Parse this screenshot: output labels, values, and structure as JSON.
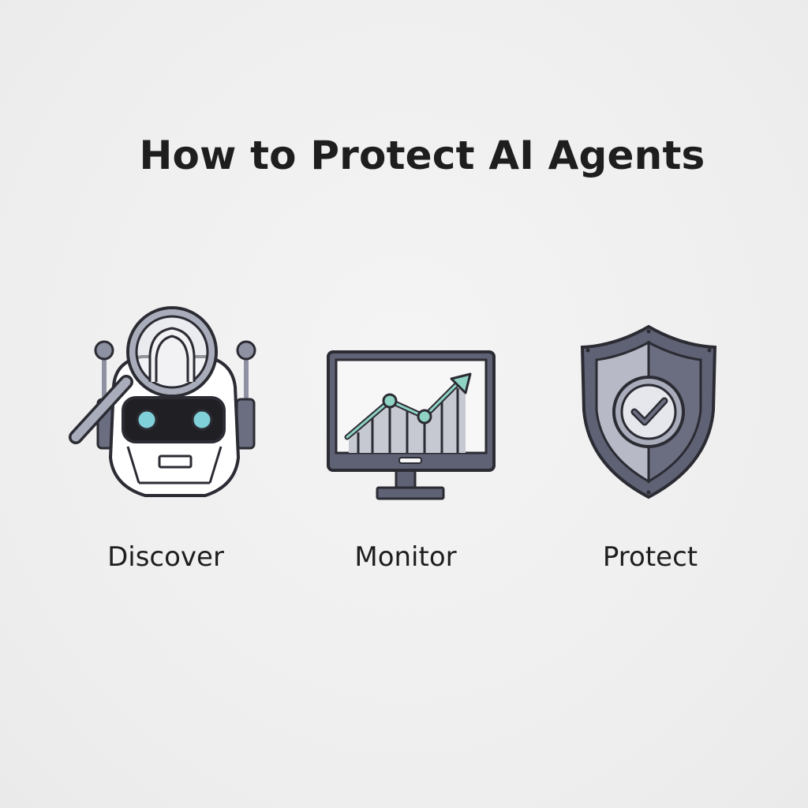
{
  "title": "How to Protect AI Agents",
  "steps": [
    {
      "label": "Discover",
      "icon": "robot-magnifier-icon"
    },
    {
      "label": "Monitor",
      "icon": "monitor-chart-icon"
    },
    {
      "label": "Protect",
      "icon": "shield-check-icon"
    }
  ],
  "colors": {
    "background": "#efefef",
    "text": "#1e1e1e",
    "outline": "#2b2b33",
    "steel_dark": "#5f6274",
    "steel_light": "#a9acba",
    "accent_teal": "#7fd0d8"
  }
}
